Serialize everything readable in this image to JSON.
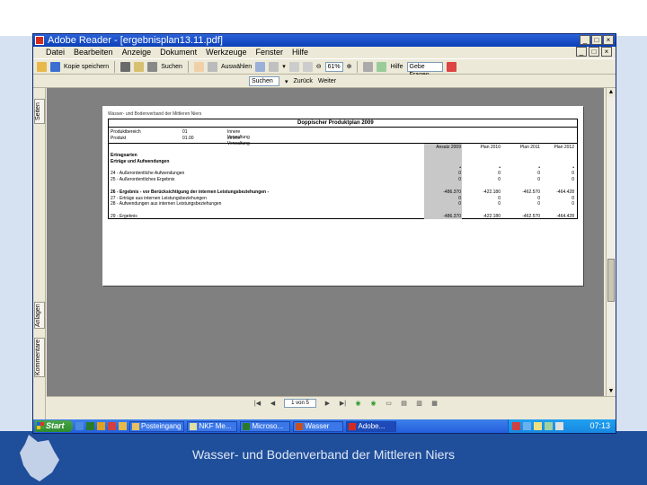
{
  "window": {
    "title": "Adobe Reader - [ergebnisplan13.11.pdf]",
    "controls_outer": [
      "_",
      "□",
      "×"
    ],
    "controls_inner": [
      "_",
      "□",
      "×"
    ]
  },
  "menu": [
    "Datei",
    "Bearbeiten",
    "Anzeige",
    "Dokument",
    "Werkzeuge",
    "Fenster",
    "Hilfe"
  ],
  "toolbar": {
    "copy_label": "Kopie speichern",
    "search_label": "Suchen",
    "select_label": "Auswählen",
    "zoom_value": "61%",
    "help_label": "Hilfe",
    "search_field": "Gebe Fragen"
  },
  "toolbar2": {
    "find_value": "Suchen",
    "back_label": "Zurück",
    "forward_label": "Weiter"
  },
  "side_tabs": [
    "Seiten",
    "Anlagen",
    "Kommentare"
  ],
  "pdf": {
    "top_line": "Wasser- und Bodenverband der Mittleren Niers",
    "title": "Doppischer Produktplan 2009",
    "header_rows": [
      {
        "k": "Produktbereich",
        "v": "01",
        "d": "Innere Verwaltung"
      },
      {
        "k": "Produkt",
        "v": "01.00",
        "d": "Innere Verwaltung"
      }
    ],
    "columns": [
      "Ansatz 2009",
      "Plan 2010",
      "Plan 2011",
      "Plan 2012"
    ],
    "rows": [
      {
        "label": "Ertragsarten",
        "vals": [
          "",
          "",
          "",
          ""
        ],
        "bold": true
      },
      {
        "label": "Erträge und Aufwendungen",
        "vals": [
          "",
          "",
          "",
          ""
        ],
        "bold": true
      },
      {
        "label": "",
        "vals": [
          "•",
          "•",
          "•",
          "•"
        ],
        "bold": false
      },
      {
        "label": "24 - Außerordentliche Aufwendungen",
        "vals": [
          "0",
          "0",
          "0",
          "0"
        ],
        "bold": false
      },
      {
        "label": "25 - Außerordentliches Ergebnis",
        "vals": [
          "0",
          "0",
          "0",
          "0"
        ],
        "bold": false
      },
      {
        "label": "",
        "vals": [
          "",
          "",
          "",
          ""
        ],
        "bold": false
      },
      {
        "label": "26 - Ergebnis - vor Berücksichtigung der internen Leistungsbeziehungen -",
        "vals": [
          "-486.370",
          "-422.180",
          "-462.570",
          "-464.428"
        ],
        "bold": true
      },
      {
        "label": "27 - Erträge aus internen Leistungsbeziehungen",
        "vals": [
          "0",
          "0",
          "0",
          "0"
        ],
        "bold": false
      },
      {
        "label": "28 - Aufwendungen aus internen Leistungsbeziehungen",
        "vals": [
          "0",
          "0",
          "0",
          "0"
        ],
        "bold": false
      },
      {
        "label": "",
        "vals": [
          "",
          "",
          "",
          ""
        ],
        "bold": false
      },
      {
        "label": "29 - Ergebnis",
        "vals": [
          "-486.370",
          "-422.180",
          "-462.570",
          "-464.428"
        ],
        "bold": false
      }
    ]
  },
  "nav": {
    "page_field": "1 von 5"
  },
  "taskbar": {
    "start_label": "Start",
    "tasks": [
      "Posteingang",
      "NKF Me...",
      "Microso...",
      "Wasser",
      "Adobe..."
    ],
    "clock": "07:13"
  },
  "slide_footer": "Wasser- und Bodenverband der Mittleren Niers"
}
